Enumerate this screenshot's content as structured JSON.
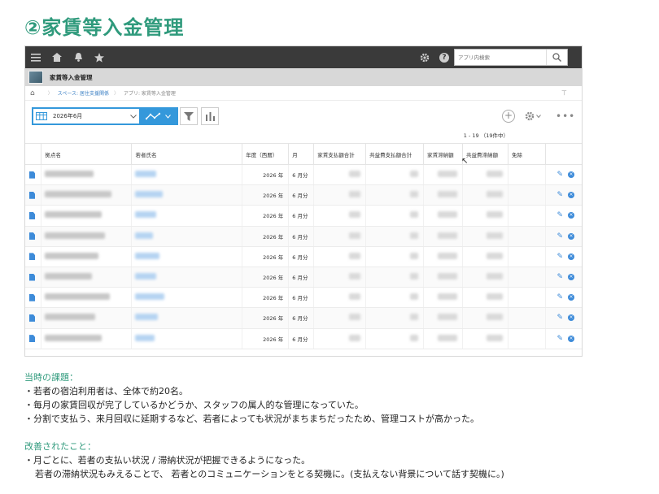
{
  "slide": {
    "title": "②家賃等入金管理"
  },
  "topbar": {
    "search_placeholder": "アプリ内検索"
  },
  "app": {
    "name": "家賃等入金管理"
  },
  "breadcrumb": {
    "space_label": "スペース: 居住支援関係",
    "app_label": "アプリ: 家賃等入金管理"
  },
  "toolbar": {
    "view_label": "2026年6月"
  },
  "pager": {
    "text": "1 - 19 （19件中）"
  },
  "table": {
    "headers": [
      "拠点名",
      "若者氏名",
      "年度（西暦）",
      "月",
      "家賃支払額合計",
      "共益費支払額合計",
      "家賃滞納額",
      "共益費滞納額",
      "免除"
    ],
    "rows": [
      {
        "year": "2026 年",
        "month": "6 月分"
      },
      {
        "year": "2026 年",
        "month": "6 月分"
      },
      {
        "year": "2026 年",
        "month": "6 月分"
      },
      {
        "year": "2026 年",
        "month": "6 月分"
      },
      {
        "year": "2026 年",
        "month": "6 月分"
      },
      {
        "year": "2026 年",
        "month": "6 月分"
      },
      {
        "year": "2026 年",
        "month": "6 月分"
      },
      {
        "year": "2026 年",
        "month": "6 月分"
      },
      {
        "year": "2026 年",
        "month": "6 月分"
      }
    ]
  },
  "notes": {
    "problems_heading": "当時の課題：",
    "problems": [
      "・若者の宿泊利用者は、全体で約20名。",
      "・毎月の家賃回収が完了しているかどうか、スタッフの属人的な管理になっていた。",
      "・分割で支払う、来月回収に延期するなど、若者によっても状況がまちまちだったため、管理コストが高かった。"
    ],
    "improvements_heading": "改善されたこと：",
    "improvements": [
      "・月ごとに、若者の支払い状況 / 滞納状況が把握できるようになった。",
      "若者の滞納状況もみえることで、 若者とのコミュニケーションをとる契機に。(支払えない背景について話す契機に。)"
    ]
  },
  "colors": {
    "accent": "#2f9a7c",
    "link_blue": "#3498db",
    "topbar": "#3a3a3a"
  }
}
